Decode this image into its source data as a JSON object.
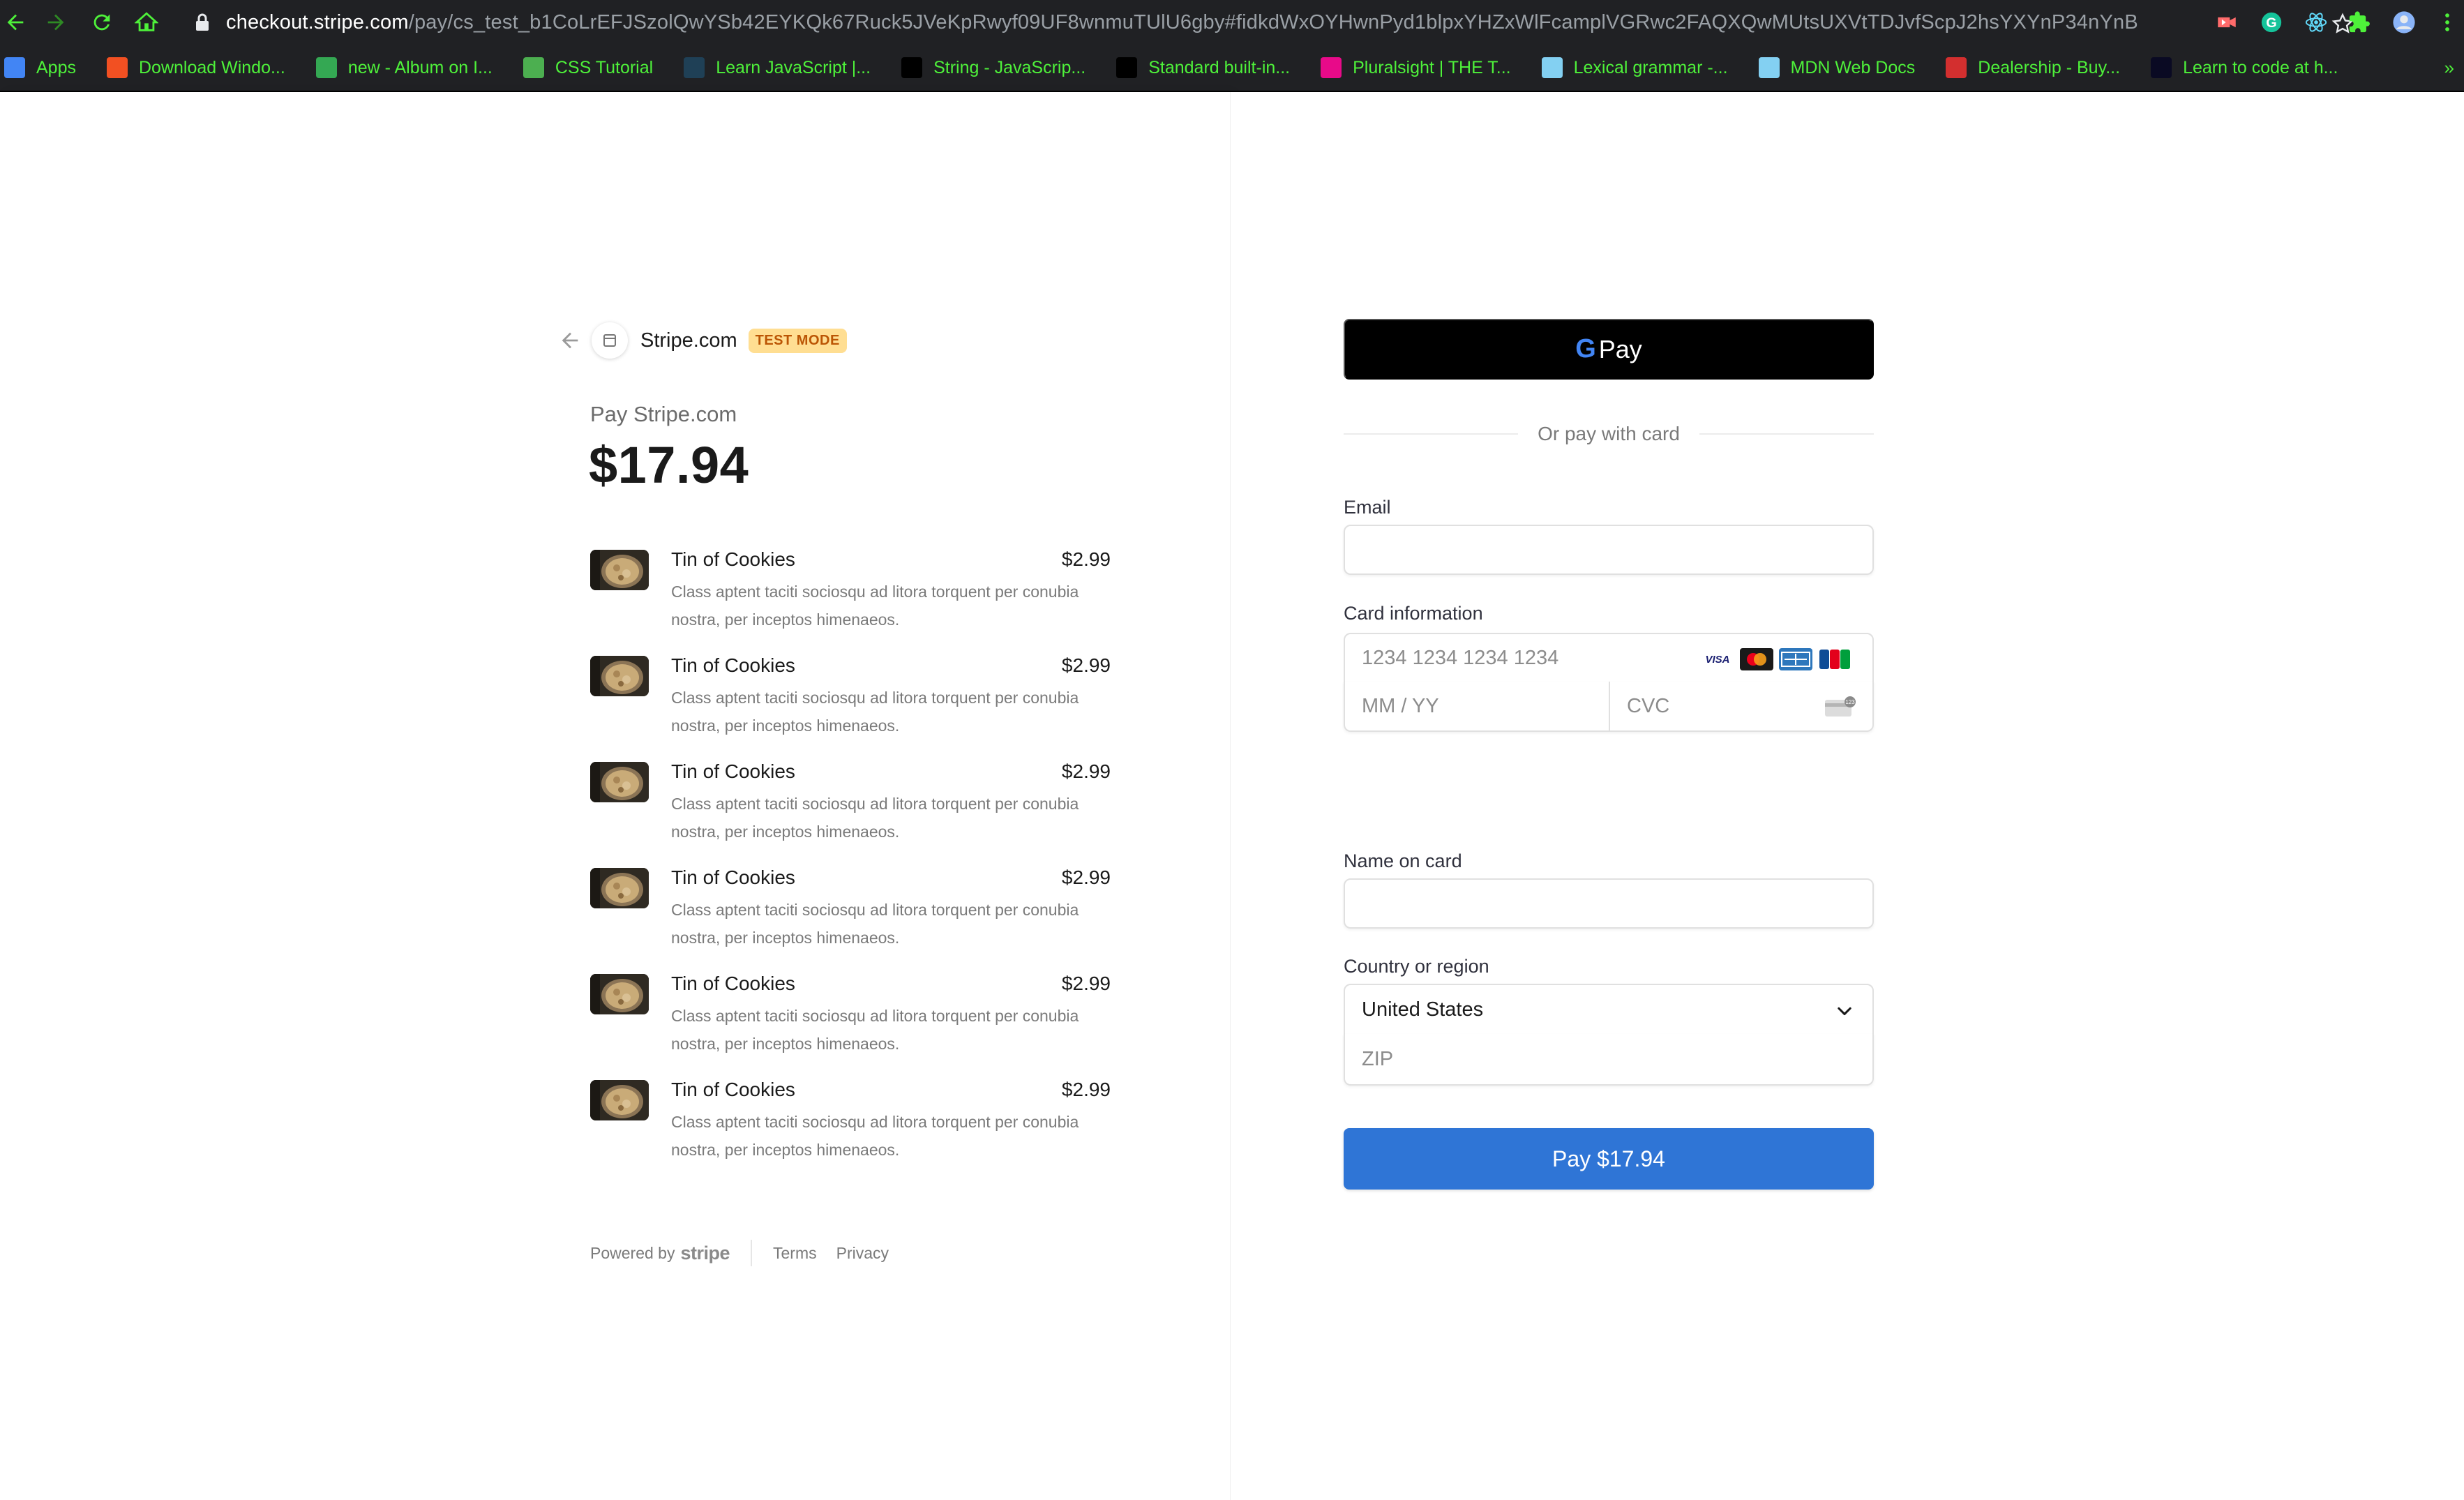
{
  "browser": {
    "url_host": "checkout.stripe.com",
    "url_path": "/pay/cs_test_b1CoLrEFJSzolQwYSb42EYKQk67Ruck5JVeKpRwyf09UF8wnmuTUlU6gby#fidkdWxOYHwnPyd1blpxYHZxWlFcamplVGRwc2FAQXQwMUtsUXVtTDJvfScpJ2hsYXYnP34nYnBs...",
    "bookmarks": [
      {
        "label": "Apps",
        "icon": "apps-grid-icon",
        "color": "#4285f4"
      },
      {
        "label": "Download Windo...",
        "icon": "windows-icon",
        "color": "#f25022"
      },
      {
        "label": "new - Album on I...",
        "icon": "album-icon",
        "color": "#34a853"
      },
      {
        "label": "CSS Tutorial",
        "icon": "w3schools-icon",
        "color": "#4caf50"
      },
      {
        "label": "Learn JavaScript |...",
        "icon": "codecademy-icon",
        "color": "#1f4056"
      },
      {
        "label": "String - JavaScrip...",
        "icon": "mdn-icon",
        "color": "#000000"
      },
      {
        "label": "Standard built-in...",
        "icon": "mdn-icon",
        "color": "#000000"
      },
      {
        "label": "Pluralsight | THE T...",
        "icon": "pluralsight-icon",
        "color": "#e80a89"
      },
      {
        "label": "Lexical grammar -...",
        "icon": "mdn-icon",
        "color": "#83d0f2"
      },
      {
        "label": "MDN Web Docs",
        "icon": "mdn-icon",
        "color": "#83d0f2"
      },
      {
        "label": "Dealership - Buy...",
        "icon": "dealership-icon",
        "color": "#d32f2f"
      },
      {
        "label": "Learn to code at h...",
        "icon": "freecodecamp-icon",
        "color": "#0a0a23"
      }
    ],
    "more": "»"
  },
  "merchant": {
    "name": "Stripe.com",
    "badge": "TEST MODE"
  },
  "summary": {
    "pay_label": "Pay Stripe.com",
    "amount": "$17.94"
  },
  "items": [
    {
      "name": "Tin of Cookies",
      "price": "$2.99",
      "description": "Class aptent taciti sociosqu ad litora torquent per conubia nostra, per inceptos himenaeos."
    },
    {
      "name": "Tin of Cookies",
      "price": "$2.99",
      "description": "Class aptent taciti sociosqu ad litora torquent per conubia nostra, per inceptos himenaeos."
    },
    {
      "name": "Tin of Cookies",
      "price": "$2.99",
      "description": "Class aptent taciti sociosqu ad litora torquent per conubia nostra, per inceptos himenaeos."
    },
    {
      "name": "Tin of Cookies",
      "price": "$2.99",
      "description": "Class aptent taciti sociosqu ad litora torquent per conubia nostra, per inceptos himenaeos."
    },
    {
      "name": "Tin of Cookies",
      "price": "$2.99",
      "description": "Class aptent taciti sociosqu ad litora torquent per conubia nostra, per inceptos himenaeos."
    },
    {
      "name": "Tin of Cookies",
      "price": "$2.99",
      "description": "Class aptent taciti sociosqu ad litora torquent per conubia nostra, per inceptos himenaeos."
    }
  ],
  "footer": {
    "powered_by": "Powered by",
    "stripe": "stripe",
    "terms": "Terms",
    "privacy": "Privacy"
  },
  "form": {
    "gpay_label": "Pay",
    "divider": "Or pay with card",
    "email_label": "Email",
    "email_value": "",
    "card_label": "Card information",
    "card_number_placeholder": "1234 1234 1234 1234",
    "card_brands": [
      "VISA",
      "mastercard",
      "amex",
      "JCB"
    ],
    "expiry_placeholder": "MM / YY",
    "cvc_placeholder": "CVC",
    "name_label": "Name on card",
    "name_value": "",
    "country_label": "Country or region",
    "country_value": "United States",
    "zip_placeholder": "ZIP",
    "pay_button": "Pay $17.94"
  },
  "colors": {
    "pay_button": "#2f75d6",
    "badge_bg": "#ffde92",
    "badge_text": "#bb5504",
    "bookmark_text": "#4ef13a"
  }
}
